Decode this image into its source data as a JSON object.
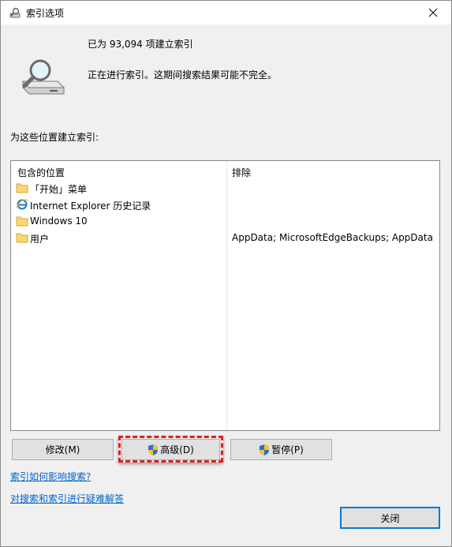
{
  "window": {
    "title": "索引选项",
    "close_symbol": "✕"
  },
  "summary": {
    "count_text": "已为 93,094 项建立索引",
    "status_text": "正在进行索引。这期间搜索结果可能不完全。"
  },
  "section_label": "为这些位置建立索引:",
  "table": {
    "headers": {
      "location": "包含的位置",
      "exclude": "排除"
    },
    "rows": [
      {
        "icon": "folder-icon",
        "name": "「开始」菜单",
        "exclude": ""
      },
      {
        "icon": "internet-explorer-icon",
        "name": "Internet Explorer 历史记录",
        "exclude": ""
      },
      {
        "icon": "folder-icon",
        "name": "Windows 10",
        "exclude": ""
      },
      {
        "icon": "folder-icon",
        "name": "用户",
        "exclude": "AppData; MicrosoftEdgeBackups; AppData"
      }
    ]
  },
  "buttons": {
    "modify": "修改(M)",
    "advanced": "高级(D)",
    "pause": "暂停(P)",
    "close": "关闭"
  },
  "links": {
    "search_effect": "索引如何影响搜索?",
    "troubleshoot": "对搜索和索引进行疑难解答"
  },
  "colors": {
    "accent": "#0078d7",
    "highlight": "#e01f1f",
    "link": "#0066cc"
  }
}
